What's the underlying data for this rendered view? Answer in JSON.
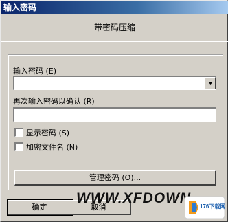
{
  "window": {
    "title": "输入密码"
  },
  "archive": {
    "subtitle": "带密码压缩"
  },
  "password": {
    "label": "输入密码 (E)",
    "value": "",
    "repeat_label": "再次输入密码以确认 (R)",
    "repeat_value": ""
  },
  "options": {
    "show_password_label": "显示密码 (S)",
    "show_password_checked": false,
    "encrypt_names_label": "加密文件名 (N)",
    "encrypt_names_checked": false
  },
  "buttons": {
    "manage_label": "管理密码 (O)...",
    "ok_label": "确定",
    "cancel_label": "取消"
  },
  "watermark": {
    "site_text": "WWW.XFDOWN",
    "logo_text": "176下载网"
  }
}
